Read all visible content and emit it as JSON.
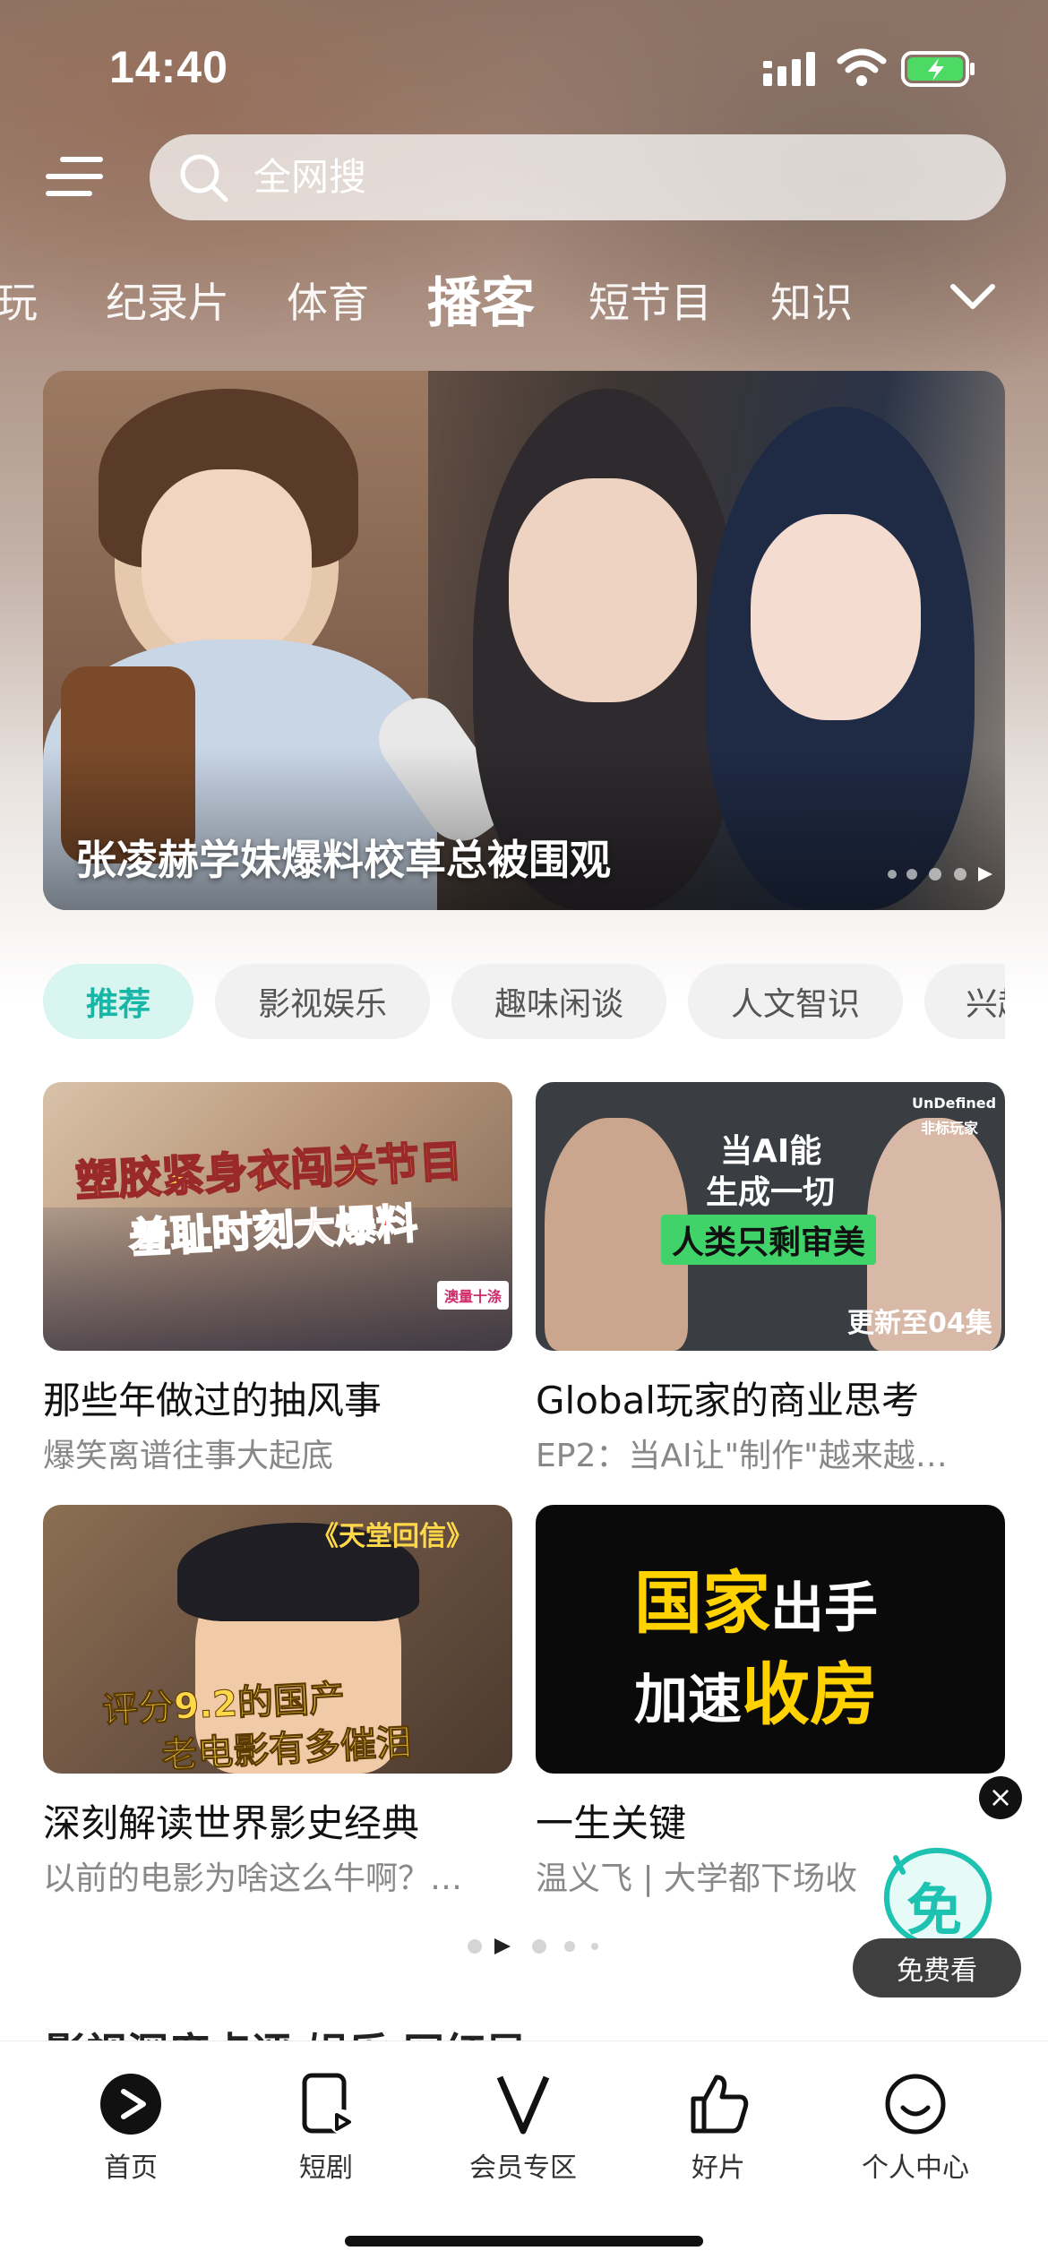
{
  "status_bar": {
    "time": "14:40"
  },
  "search": {
    "placeholder": "全网搜"
  },
  "categories": [
    "玩",
    "纪录片",
    "体育",
    "播客",
    "短节目",
    "知识"
  ],
  "banner": {
    "caption": "张凌赫学妹爆料校草总被围观"
  },
  "filter_pills": [
    "推荐",
    "影视娱乐",
    "趣味闲谈",
    "人文智识",
    "兴趣"
  ],
  "cards": [
    {
      "title": "那些年做过的抽风事",
      "subtitle": "爆笑离谱往事大起底",
      "thumb_line1": "塑胶紧身衣闯关节目",
      "thumb_line2": "羞耻时刻大爆料",
      "thumb_tag": "澳量十涤"
    },
    {
      "title": "Global玩家的商业思考",
      "subtitle": "EP2：当AI让\"制作\"越来越…",
      "thumb_line1": "当AI能",
      "thumb_line2": "生成一切",
      "thumb_line3": "人类只剩审美",
      "thumb_badge": "更新至04集",
      "thumb_brand": "UnDefined",
      "thumb_brand_sub": "非标玩家"
    },
    {
      "title": "深刻解读世界影史经典",
      "subtitle": "以前的电影为啥这么牛啊？…",
      "thumb_top": "《天堂回信》",
      "thumb_line1": "评分9.2的国产",
      "thumb_line2": "老电影有多催泪"
    },
    {
      "title": "一生关键",
      "subtitle": "温义飞 | 大学都下场收",
      "thumb_line1a": "国家",
      "thumb_line1b": "出手",
      "thumb_line2a": "加速",
      "thumb_line2b": "收房"
    }
  ],
  "floating": {
    "close": "×",
    "badge": "免",
    "button": "免费看"
  },
  "section_peek": "影视深度点评  娱乐  网红局",
  "bottom_nav": [
    "首页",
    "短剧",
    "会员专区",
    "好片",
    "个人中心"
  ],
  "colors": {
    "accent": "#18b6a6",
    "pill_active_bg": "#d9f5f0"
  }
}
